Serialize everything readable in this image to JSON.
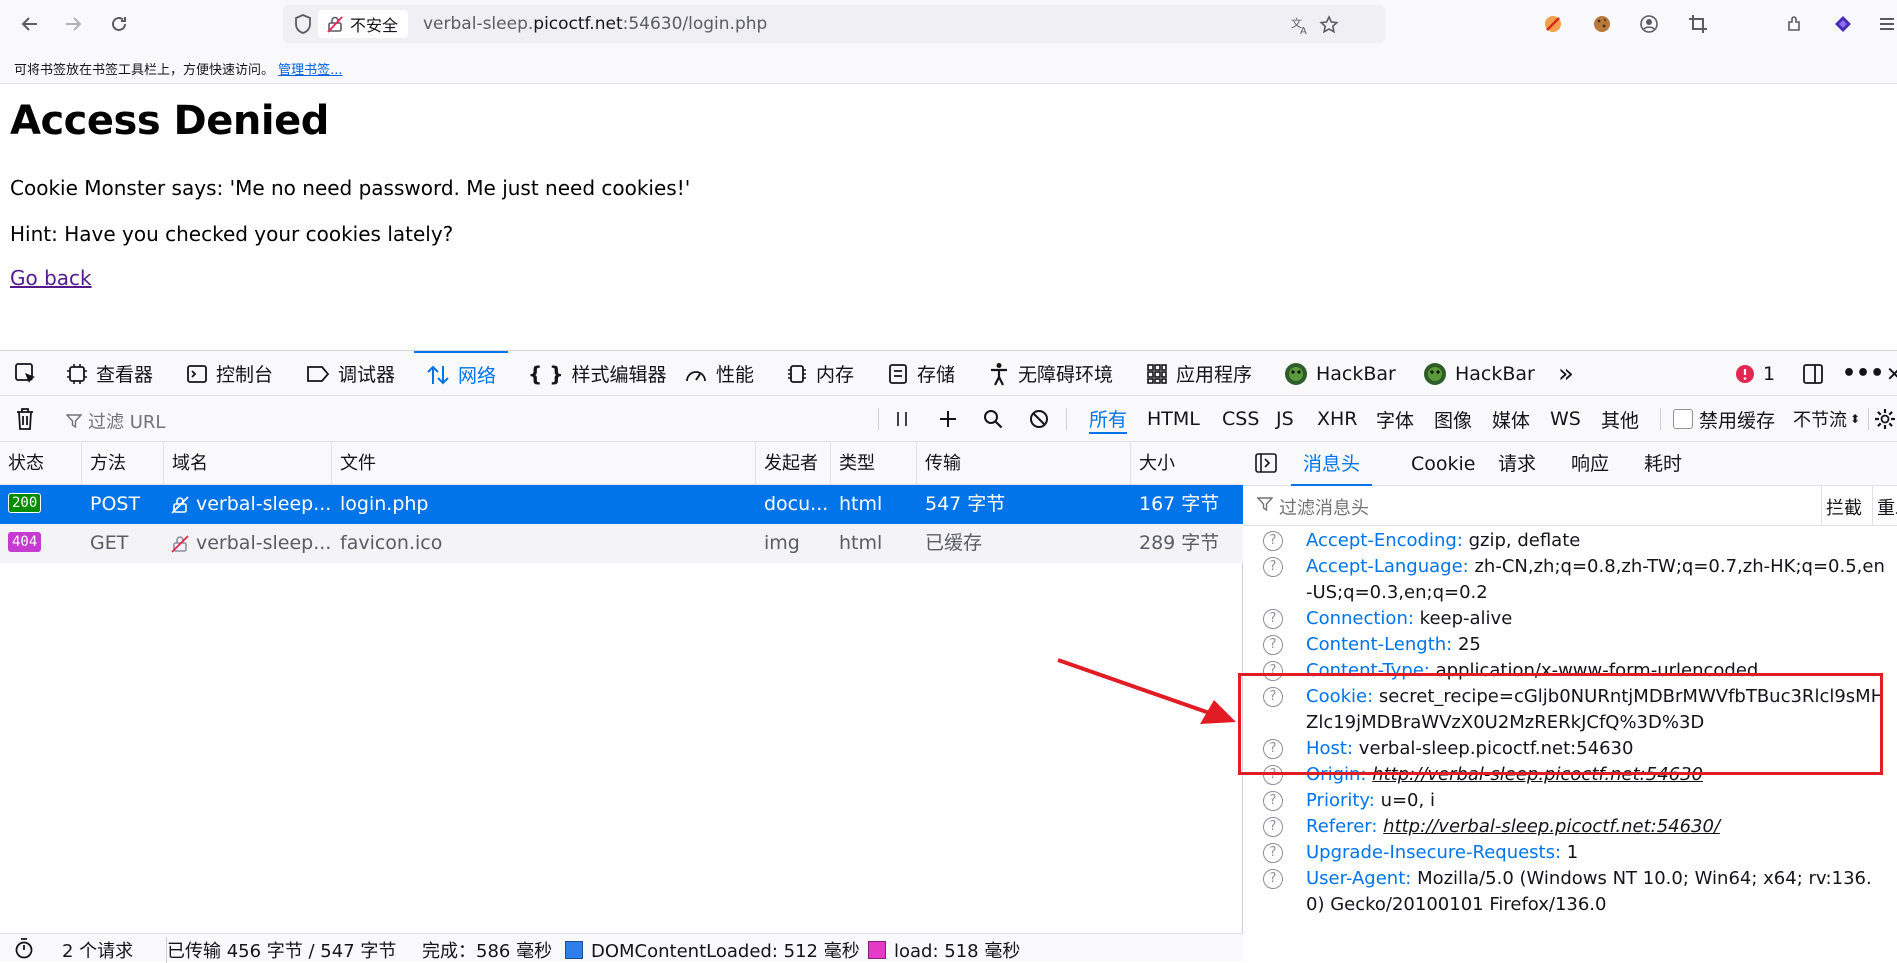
{
  "browser": {
    "security_label": "不安全",
    "url_host_prefix": "verbal-sleep.",
    "url_host": "picoctf.net",
    "url_rest": ":54630/login.php",
    "bookmarks_hint": "可将书签放在书签工具栏上，方便快速访问。",
    "bookmarks_manage": "管理书签..."
  },
  "page": {
    "title": "Access Denied",
    "line1": "Cookie Monster says: 'Me no need password. Me just need cookies!'",
    "line2": "Hint: Have you checked your cookies lately?",
    "link": "Go back"
  },
  "devtools": {
    "tabs": [
      "查看器",
      "控制台",
      "调试器",
      "网络",
      "样式编辑器",
      "性能",
      "内存",
      "存储",
      "无障碍环境",
      "应用程序",
      "HackBar",
      "HackBar"
    ],
    "error_count": "1",
    "filter_placeholder": "过滤 URL",
    "type_filters": [
      "所有",
      "HTML",
      "CSS",
      "JS",
      "XHR",
      "字体",
      "图像",
      "媒体",
      "WS",
      "其他"
    ],
    "disable_cache": "禁用缓存",
    "throttle": "不节流",
    "columns": [
      "状态",
      "方法",
      "域名",
      "文件",
      "发起者",
      "类型",
      "传输",
      "大小"
    ],
    "requests": [
      {
        "status": "200",
        "method": "POST",
        "domain": "verbal-sleep....",
        "file": "login.php",
        "initiator": "docu...",
        "type": "html",
        "transfer": "547 字节",
        "size": "167 字节"
      },
      {
        "status": "404",
        "method": "GET",
        "domain": "verbal-sleep....",
        "file": "favicon.ico",
        "initiator": "img",
        "type": "html",
        "transfer": "已缓存",
        "size": "289 字节"
      }
    ],
    "status_bar": {
      "requests": "2 个请求",
      "transferred": "已传输 456 字节 / 547 字节",
      "finish": "完成：586 毫秒",
      "dcl": "DOMContentLoaded: 512 毫秒",
      "load": "load: 518 毫秒"
    },
    "side_tabs": [
      "消息头",
      "Cookie",
      "请求",
      "响应",
      "耗时"
    ],
    "side_filter": "过滤消息头",
    "side_block": "拦截",
    "side_resend": "重发",
    "headers": [
      {
        "k": "Accept-Encoding:",
        "v": "gzip, deflate"
      },
      {
        "k": "Accept-Language:",
        "v": "zh-CN,zh;q=0.8,zh-TW;q=0.7,zh-HK;q=0.5,en-US;q=0.3,en;q=0.2"
      },
      {
        "k": "Connection:",
        "v": "keep-alive"
      },
      {
        "k": "Content-Length:",
        "v": "25"
      },
      {
        "k": "Content-Type:",
        "v": "application/x-www-form-urlencoded"
      },
      {
        "k": "Cookie:",
        "v": "secret_recipe=cGljb0NURntjMDBrMWVfbTBuc3Rlcl9sMHZlc19jMDBraWVzX0U2MzRERkJCfQ%3D%3D"
      },
      {
        "k": "Host:",
        "v": "verbal-sleep.picoctf.net:54630"
      },
      {
        "k": "Origin:",
        "v": "http://verbal-sleep.picoctf.net:54630"
      },
      {
        "k": "Priority:",
        "v": "u=0, i"
      },
      {
        "k": "Referer:",
        "v": "http://verbal-sleep.picoctf.net:54630/"
      },
      {
        "k": "Upgrade-Insecure-Requests:",
        "v": "1"
      },
      {
        "k": "User-Agent:",
        "v": "Mozilla/5.0 (Windows NT 10.0; Win64; x64; rv:136.0) Gecko/20100101 Firefox/136.0"
      }
    ]
  },
  "colors": {
    "accent": "#0074e8",
    "annotation": "#e21c25"
  }
}
